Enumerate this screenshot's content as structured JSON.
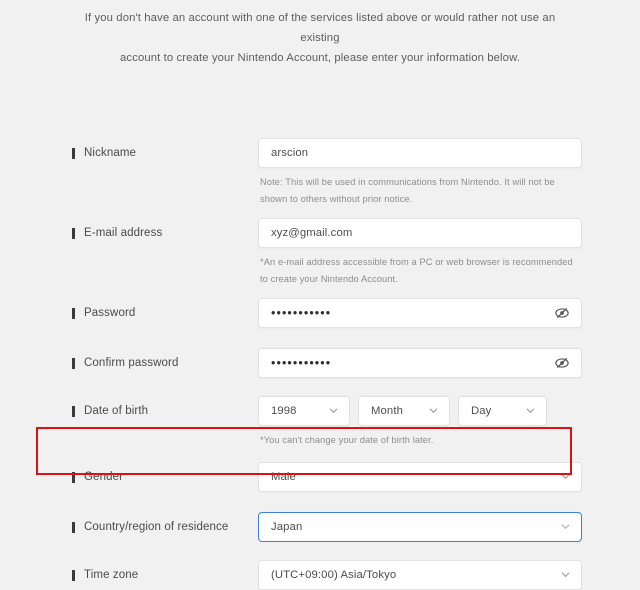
{
  "intro": {
    "line1": "If you don't have an account with one of the services listed above or would rather not use an existing",
    "line2": "account to create your Nintendo Account, please enter your information below."
  },
  "fields": {
    "nickname": {
      "label": "Nickname",
      "value": "arscion",
      "note": "Note: This will be used in communications from Nintendo. It will not be shown to others without prior notice."
    },
    "email": {
      "label": "E-mail address",
      "value": "xyz@gmail.com",
      "note": "*An e-mail address accessible from a PC or web browser is recommended to create your Nintendo Account."
    },
    "password": {
      "label": "Password",
      "value": "•••••••••••",
      "toggle_icon": "eye-slash-icon"
    },
    "confirm_password": {
      "label": "Confirm password",
      "value": "•••••••••••",
      "toggle_icon": "eye-slash-icon"
    },
    "date_of_birth": {
      "label": "Date of birth",
      "year": "1998",
      "month": "Month",
      "day": "Day",
      "note": "*You can't change your date of birth later."
    },
    "gender": {
      "label": "Gender",
      "value": "Male"
    },
    "country": {
      "label": "Country/region of residence",
      "value": "Japan"
    },
    "timezone": {
      "label": "Time zone",
      "value": "(UTC+09:00) Asia/Tokyo"
    }
  },
  "icons": {
    "chevron": "chevron-down-icon",
    "eye": "eye-slash-icon"
  },
  "colors": {
    "background": "#f1f1f1",
    "field_background": "#ffffff",
    "field_border": "#e2e2e2",
    "focus_border": "#3c7fdd",
    "annotation": "#dd1111",
    "label_text": "#4a4a4a",
    "note_text": "#8d8d8d"
  }
}
